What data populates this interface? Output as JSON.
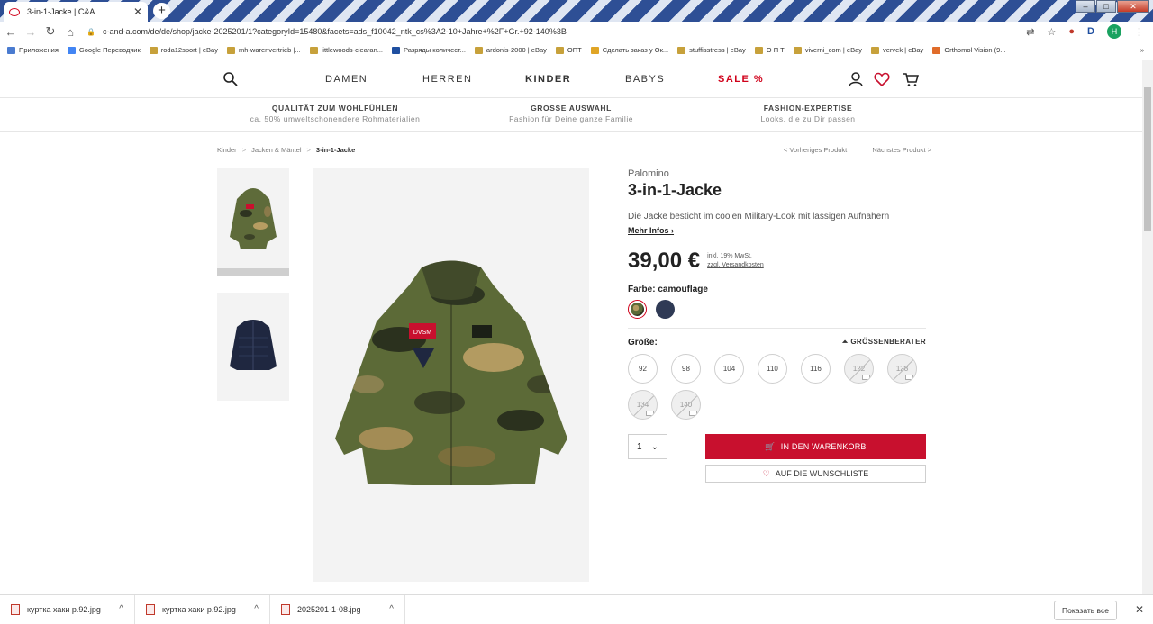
{
  "browser": {
    "tab_title": "3-in-1-Jacke | C&A",
    "tab_close": "✕",
    "new_tab": "+",
    "url": "c-and-a.com/de/de/shop/jacke-2025201/1?categoryId=15480&facets=ads_f10042_ntk_cs%3A2-10+Jahre+%2F+Gr.+92-140%3B",
    "profile_initial": "H",
    "bookmarks": [
      "Приложения",
      "Google Переводчик",
      "roda12sport | eBay",
      "mh-warenvertrieb |...",
      "littlewoods-clearan...",
      "Разряды количест...",
      "ardonis-2000 | eBay",
      "ОПТ",
      "Сделать заказ у Ок...",
      "stuffisstress | eBay",
      "О П Т",
      "viverni_com | eBay",
      "vervek | eBay",
      "Orthomol Vision (9..."
    ],
    "bookmarks_overflow": "»"
  },
  "nav": {
    "items": [
      "DAMEN",
      "HERREN",
      "KINDER",
      "BABYS",
      "SALE %"
    ],
    "active": "KINDER"
  },
  "usp": [
    {
      "title": "QUALITÄT ZUM WOHLFÜHLEN",
      "subtitle": "ca. 50% umweltschonendere Rohmaterialien"
    },
    {
      "title": "GROSSE AUSWAHL",
      "subtitle": "Fashion für Deine ganze Familie"
    },
    {
      "title": "FASHION-EXPERTISE",
      "subtitle": "Looks, die zu Dir passen"
    }
  ],
  "breadcrumb": {
    "items": [
      "Kinder",
      "Jacken & Mäntel",
      "3-in-1-Jacke"
    ],
    "separator": ">"
  },
  "product_nav": {
    "prev": "< Vorheriges Produkt",
    "next": "Nächstes Produkt >"
  },
  "product": {
    "brand": "Palomino",
    "title": "3-in-1-Jacke",
    "description": "Die Jacke besticht im coolen Military-Look mit lässigen Aufnähern",
    "more": "Mehr Infos",
    "price": "39,00 €",
    "price_note_1": "inkl. 19% MwSt.",
    "price_note_2": "zzgl. Versandkosten",
    "color_label": "Farbe: camouflage",
    "swatch_colors": [
      "#6b6a3c",
      "#2f3a55"
    ],
    "size_label": "Größe:",
    "size_advisor": "GRÖSSENBERATER",
    "sizes": [
      {
        "label": "92",
        "available": true
      },
      {
        "label": "98",
        "available": true
      },
      {
        "label": "104",
        "available": true
      },
      {
        "label": "110",
        "available": true
      },
      {
        "label": "116",
        "available": true
      },
      {
        "label": "122",
        "available": false
      },
      {
        "label": "128",
        "available": false
      },
      {
        "label": "134",
        "available": false
      },
      {
        "label": "140",
        "available": false
      }
    ],
    "quantity": "1",
    "add_to_cart": "IN DEN WARENKORB",
    "wishlist": "AUF DIE WUNSCHLISTE"
  },
  "downloads": {
    "files": [
      "куртка хаки р.92.jpg",
      "куртка хаки р.92.jpg",
      "2025201-1-08.jpg"
    ],
    "show_all": "Показать все",
    "close": "✕"
  },
  "colors": {
    "brand_red": "#c8102e",
    "sale_red": "#d0021b"
  }
}
